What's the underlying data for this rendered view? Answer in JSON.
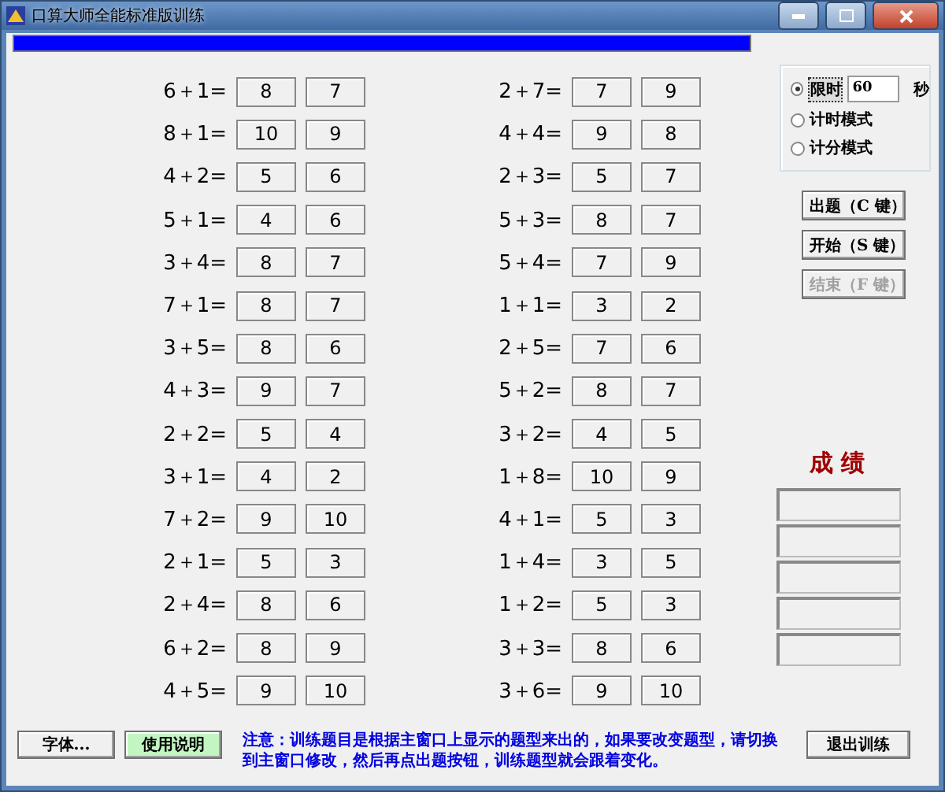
{
  "window": {
    "title": "口算大师全能标准版训练"
  },
  "progress": {
    "level": 1
  },
  "problems_left": [
    {
      "question": "6＋1=",
      "answers": [
        "8",
        "7"
      ]
    },
    {
      "question": "8＋1=",
      "answers": [
        "10",
        "9"
      ]
    },
    {
      "question": "4＋2=",
      "answers": [
        "5",
        "6"
      ]
    },
    {
      "question": "5＋1=",
      "answers": [
        "4",
        "6"
      ]
    },
    {
      "question": "3＋4=",
      "answers": [
        "8",
        "7"
      ]
    },
    {
      "question": "7＋1=",
      "answers": [
        "8",
        "7"
      ]
    },
    {
      "question": "3＋5=",
      "answers": [
        "8",
        "6"
      ]
    },
    {
      "question": "4＋3=",
      "answers": [
        "9",
        "7"
      ]
    },
    {
      "question": "2＋2=",
      "answers": [
        "5",
        "4"
      ]
    },
    {
      "question": "3＋1=",
      "answers": [
        "4",
        "2"
      ]
    },
    {
      "question": "7＋2=",
      "answers": [
        "9",
        "10"
      ]
    },
    {
      "question": "2＋1=",
      "answers": [
        "5",
        "3"
      ]
    },
    {
      "question": "2＋4=",
      "answers": [
        "8",
        "6"
      ]
    },
    {
      "question": "6＋2=",
      "answers": [
        "8",
        "9"
      ]
    },
    {
      "question": "4＋5=",
      "answers": [
        "9",
        "10"
      ]
    }
  ],
  "problems_right": [
    {
      "question": "2＋7=",
      "answers": [
        "7",
        "9"
      ]
    },
    {
      "question": "4＋4=",
      "answers": [
        "9",
        "8"
      ]
    },
    {
      "question": "2＋3=",
      "answers": [
        "5",
        "7"
      ]
    },
    {
      "question": "5＋3=",
      "answers": [
        "8",
        "7"
      ]
    },
    {
      "question": "5＋4=",
      "answers": [
        "7",
        "9"
      ]
    },
    {
      "question": "1＋1=",
      "answers": [
        "3",
        "2"
      ]
    },
    {
      "question": "2＋5=",
      "answers": [
        "7",
        "6"
      ]
    },
    {
      "question": "5＋2=",
      "answers": [
        "8",
        "7"
      ]
    },
    {
      "question": "3＋2=",
      "answers": [
        "4",
        "5"
      ]
    },
    {
      "question": "1＋8=",
      "answers": [
        "10",
        "9"
      ]
    },
    {
      "question": "4＋1=",
      "answers": [
        "5",
        "3"
      ]
    },
    {
      "question": "1＋4=",
      "answers": [
        "3",
        "5"
      ]
    },
    {
      "question": "1＋2=",
      "answers": [
        "5",
        "3"
      ]
    },
    {
      "question": "3＋3=",
      "answers": [
        "8",
        "6"
      ]
    },
    {
      "question": "3＋6=",
      "answers": [
        "9",
        "10"
      ]
    }
  ],
  "mode": [
    {
      "kind": "timed",
      "label": "限时",
      "selected": true,
      "value": "60",
      "unit": "秒"
    },
    {
      "kind": "plain",
      "label": "计时模式",
      "selected": false
    },
    {
      "kind": "plain",
      "label": "计分模式",
      "selected": false
    }
  ],
  "actions": [
    {
      "label": "出题（C 键）",
      "disabled": false
    },
    {
      "label": "开始（S 键）",
      "disabled": false
    },
    {
      "label": "结束（F 键）",
      "disabled": true
    }
  ],
  "score": {
    "title": "成 绩"
  },
  "footer": {
    "buttons": [
      {
        "label": "字体...",
        "kind": "plain"
      },
      {
        "label": "使用说明",
        "kind": "highlight"
      }
    ],
    "note": "注意：训练题目是根据主窗口上显示的题型来出的，如果要改变题型，请切换到主窗口修改，然后再点出题按钮，训练题型就会跟着变化。",
    "exit": "退出训练"
  }
}
